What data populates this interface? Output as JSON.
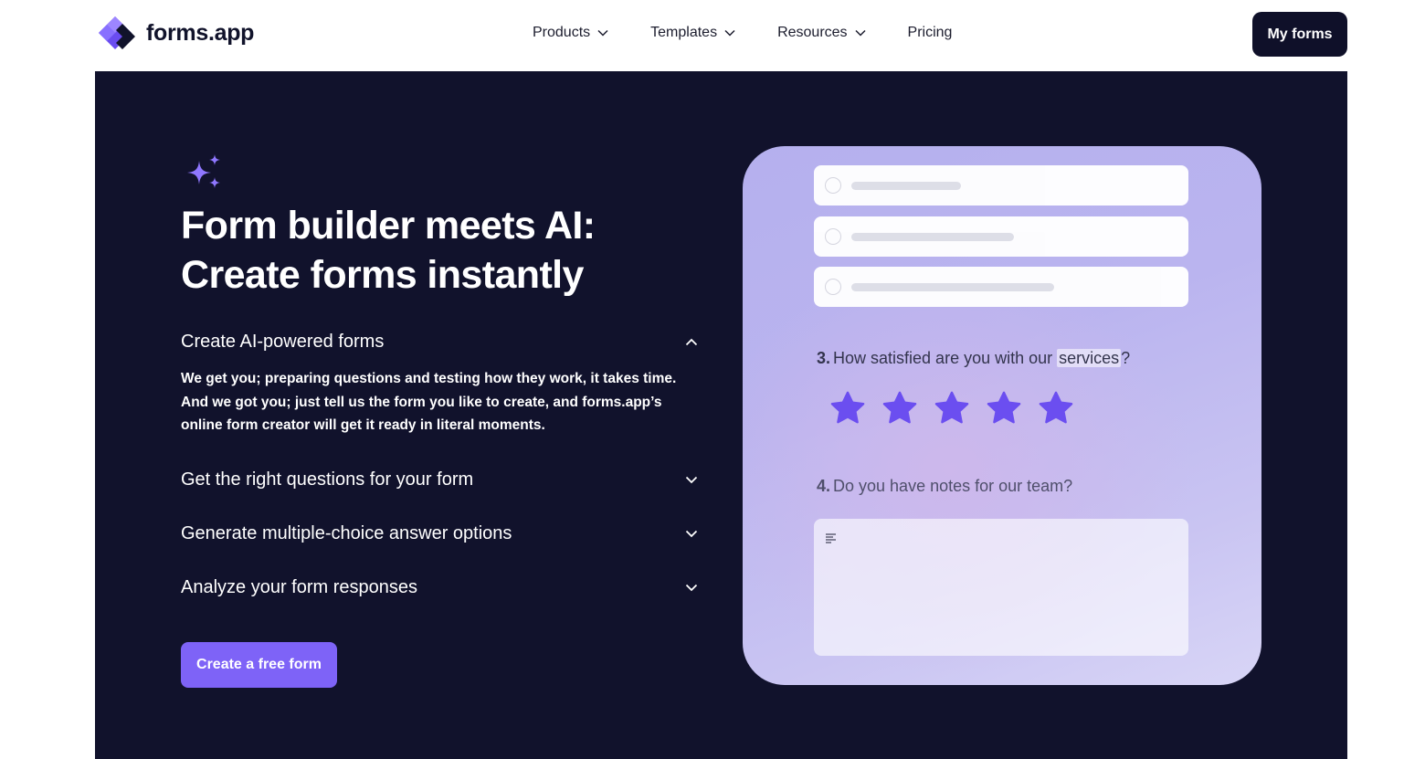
{
  "brand": {
    "name": "forms.app",
    "logo_icon": "forms-app-logo-icon",
    "colors": {
      "primary": "#7e63f7",
      "dark": "#11122c"
    }
  },
  "nav": {
    "items": [
      {
        "label": "Products",
        "has_dropdown": true
      },
      {
        "label": "Templates",
        "has_dropdown": true
      },
      {
        "label": "Resources",
        "has_dropdown": true
      },
      {
        "label": "Pricing",
        "has_dropdown": false
      }
    ],
    "my_forms_label": "My forms"
  },
  "hero": {
    "icon": "sparkles-icon",
    "title_line1": "Form builder meets AI:",
    "title_line2": "Create forms instantly",
    "accordion": [
      {
        "title": "Create AI-powered forms",
        "expanded": true,
        "body": "We get you; preparing questions and testing how they work, it takes time. And we got you; just tell us the form you like to create, and forms.app’s online form creator will get it ready in literal moments."
      },
      {
        "title": "Get the right questions for your form",
        "expanded": false
      },
      {
        "title": "Generate multiple-choice answer options",
        "expanded": false
      },
      {
        "title": "Analyze your form responses",
        "expanded": false
      }
    ],
    "cta_label": "Create a free form"
  },
  "preview": {
    "question3": {
      "number": "3.",
      "text_before": "How satisfied are you with our ",
      "highlight": "services",
      "text_after": "?"
    },
    "rating": {
      "max": 5,
      "value": 5,
      "icon": "star-icon",
      "color": "#6b4ef0"
    },
    "question4": {
      "number": "4.",
      "text": "Do you have notes for our team?"
    },
    "textarea_icon": "text-align-left-icon"
  }
}
